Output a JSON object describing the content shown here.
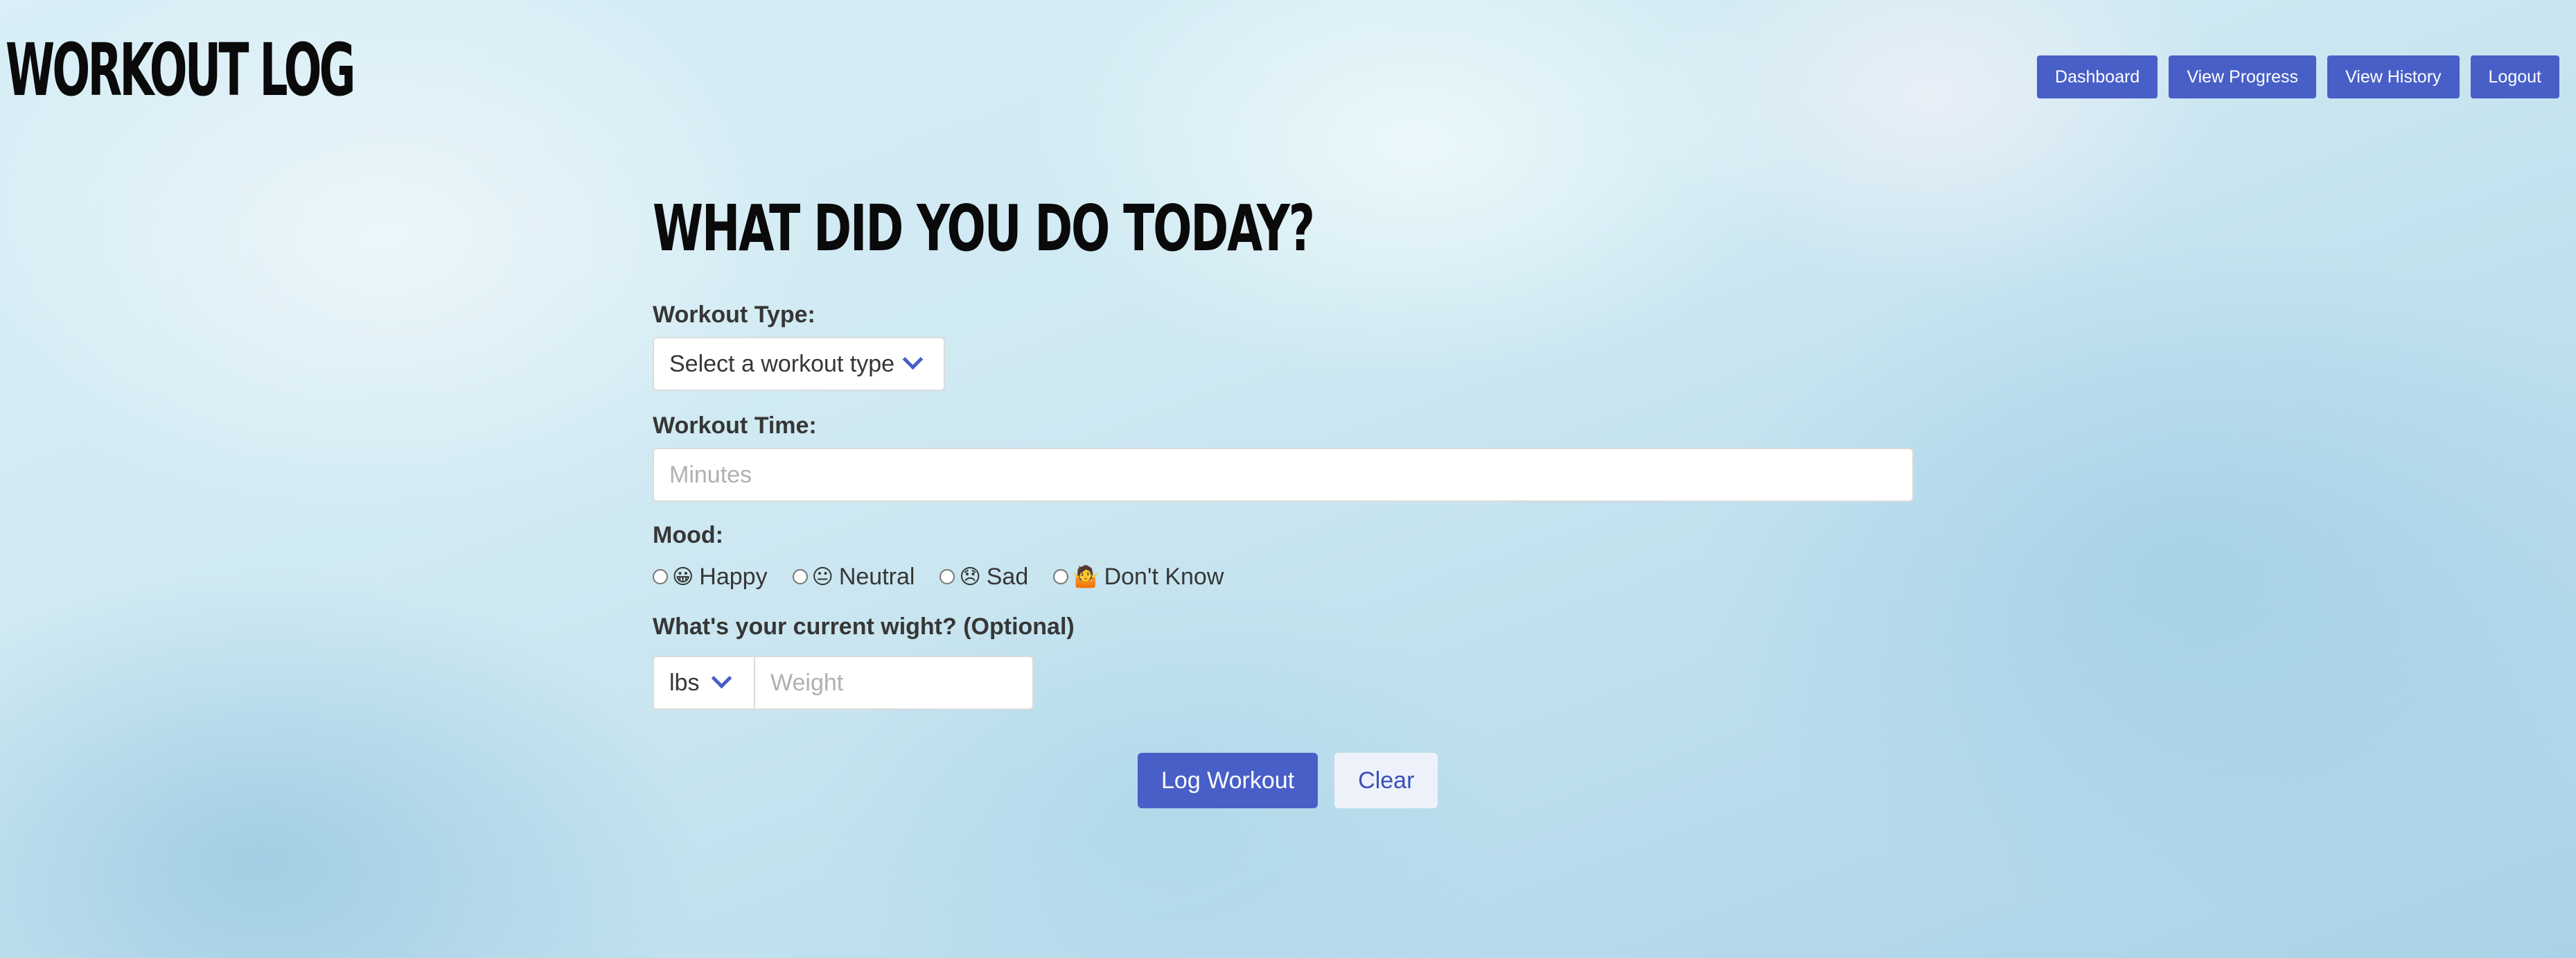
{
  "app": {
    "brand": "WORKOUT LOG"
  },
  "nav": {
    "items": [
      {
        "label": "Dashboard"
      },
      {
        "label": "View Progress"
      },
      {
        "label": "View History"
      },
      {
        "label": "Logout"
      }
    ]
  },
  "form": {
    "title": "WHAT DID YOU DO TODAY?",
    "workout_type": {
      "label": "Workout Type:",
      "selected": "Select a workout type"
    },
    "workout_time": {
      "label": "Workout Time:",
      "value": "",
      "placeholder": "Minutes"
    },
    "mood": {
      "label": "Mood:",
      "options": [
        {
          "emoji": "😀",
          "label": "Happy",
          "checked": false
        },
        {
          "emoji": "😐",
          "label": "Neutral",
          "checked": false
        },
        {
          "emoji": "😞",
          "label": "Sad",
          "checked": false
        },
        {
          "emoji": "🤷",
          "label": "Don't Know",
          "checked": false
        }
      ]
    },
    "weight": {
      "label": "What's your current wight? (Optional)",
      "unit_selected": "lbs",
      "value": "",
      "placeholder": "Weight"
    },
    "actions": {
      "submit_label": "Log Workout",
      "clear_label": "Clear"
    }
  },
  "colors": {
    "primary": "#485fc7",
    "light_button_bg": "#eff1fa",
    "light_button_text": "#3850b7",
    "title_text": "#0a0a0a",
    "label_text": "#363636"
  }
}
